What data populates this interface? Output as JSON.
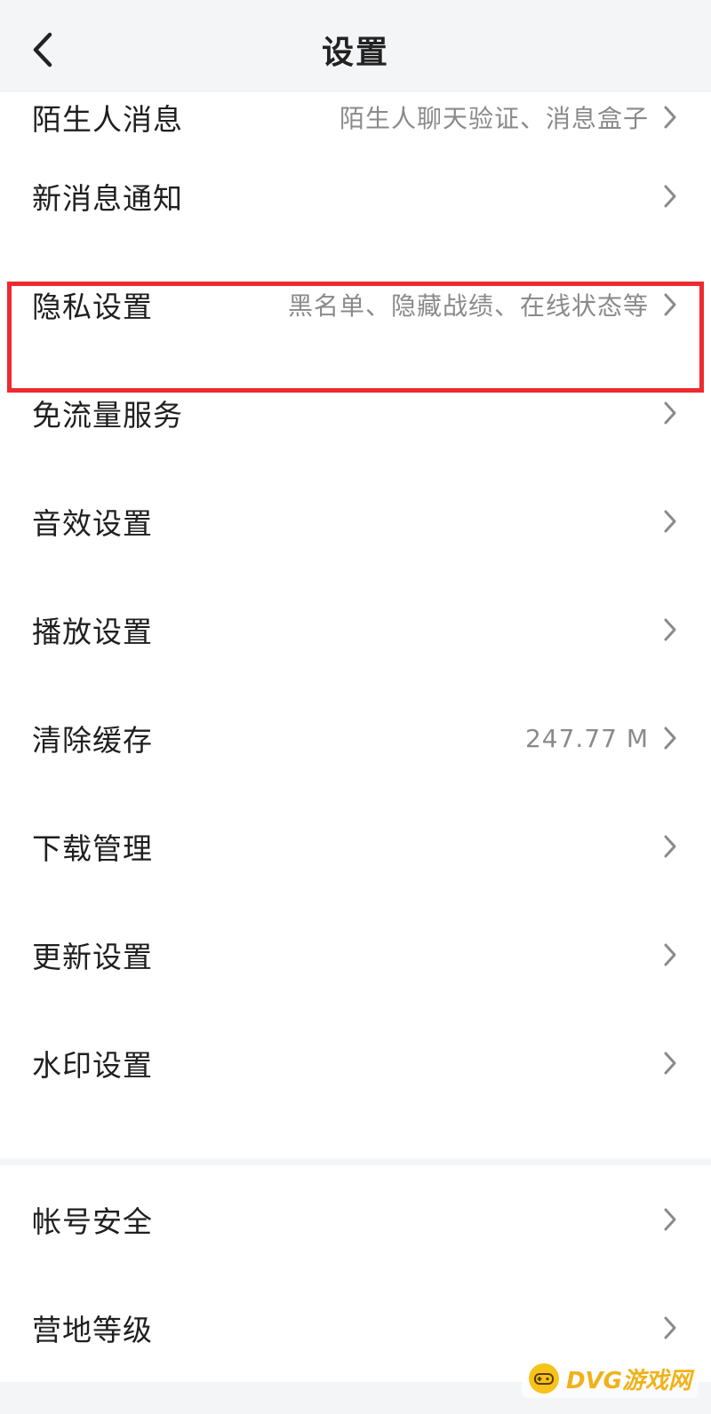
{
  "header": {
    "title": "设置",
    "back_icon": "chevron-left-icon"
  },
  "settings": {
    "stranger_messages": {
      "label": "陌生人消息",
      "value": "陌生人聊天验证、消息盒子"
    },
    "new_message_notifications": {
      "label": "新消息通知"
    },
    "privacy_settings": {
      "label": "隐私设置",
      "value": "黑名单、隐藏战绩、在线状态等"
    },
    "free_data_service": {
      "label": "免流量服务"
    },
    "sound_settings": {
      "label": "音效设置"
    },
    "playback_settings": {
      "label": "播放设置"
    },
    "clear_cache": {
      "label": "清除缓存",
      "value": "247.77 M"
    },
    "download_management": {
      "label": "下载管理"
    },
    "update_settings": {
      "label": "更新设置"
    },
    "watermark_settings": {
      "label": "水印设置"
    },
    "account_security": {
      "label": "帐号安全"
    },
    "camp_level": {
      "label": "营地等级"
    }
  },
  "colors": {
    "highlight_border": "#ee2a2f",
    "background": "#f4f5f7",
    "row_background": "#ffffff"
  },
  "watermark": {
    "text": "DVG游戏网"
  }
}
